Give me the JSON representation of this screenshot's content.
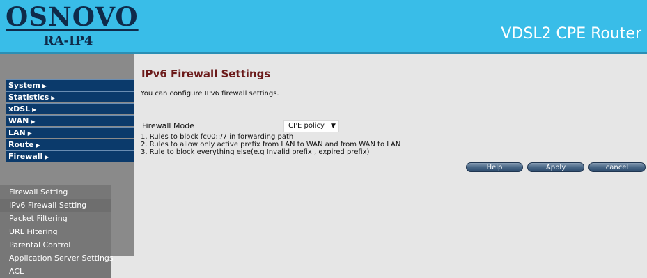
{
  "header": {
    "brand": "OSNOVO",
    "model": "RA-IP4",
    "product": "VDSL2 CPE Router"
  },
  "sidebar": {
    "menu": [
      {
        "label": "System"
      },
      {
        "label": "Statistics"
      },
      {
        "label": "xDSL"
      },
      {
        "label": "WAN"
      },
      {
        "label": "LAN"
      },
      {
        "label": "Route"
      },
      {
        "label": "Firewall"
      }
    ],
    "submenu": [
      {
        "label": "Firewall Setting"
      },
      {
        "label": "IPv6 Firewall Setting"
      },
      {
        "label": "Packet Filtering"
      },
      {
        "label": "URL Filtering"
      },
      {
        "label": "Parental Control"
      },
      {
        "label": "Application Server Settings"
      },
      {
        "label": "ACL"
      }
    ]
  },
  "main": {
    "title": "IPv6 Firewall Settings",
    "description": "You can configure IPv6 firewall settings.",
    "firewall_mode_label": "Firewall Mode",
    "firewall_mode_value": "CPE policy",
    "rules": [
      "1. Rules to block fc00::/7 in forwarding path",
      "2. Rules to allow only active prefix from LAN to WAN and from WAN to LAN",
      "3. Rule to block everything else(e.g Invalid prefix , expired prefix)"
    ],
    "buttons": {
      "help": "Help",
      "apply": "Apply",
      "cancel": "cancel"
    }
  },
  "icons": {
    "menu_arrow": "triangle-right-icon",
    "select_chevron": "chevron-down-icon"
  },
  "colors": {
    "header_bg": "#39bde8",
    "menu_bg": "#0b3a6b",
    "title_color": "#6b1a1a"
  }
}
